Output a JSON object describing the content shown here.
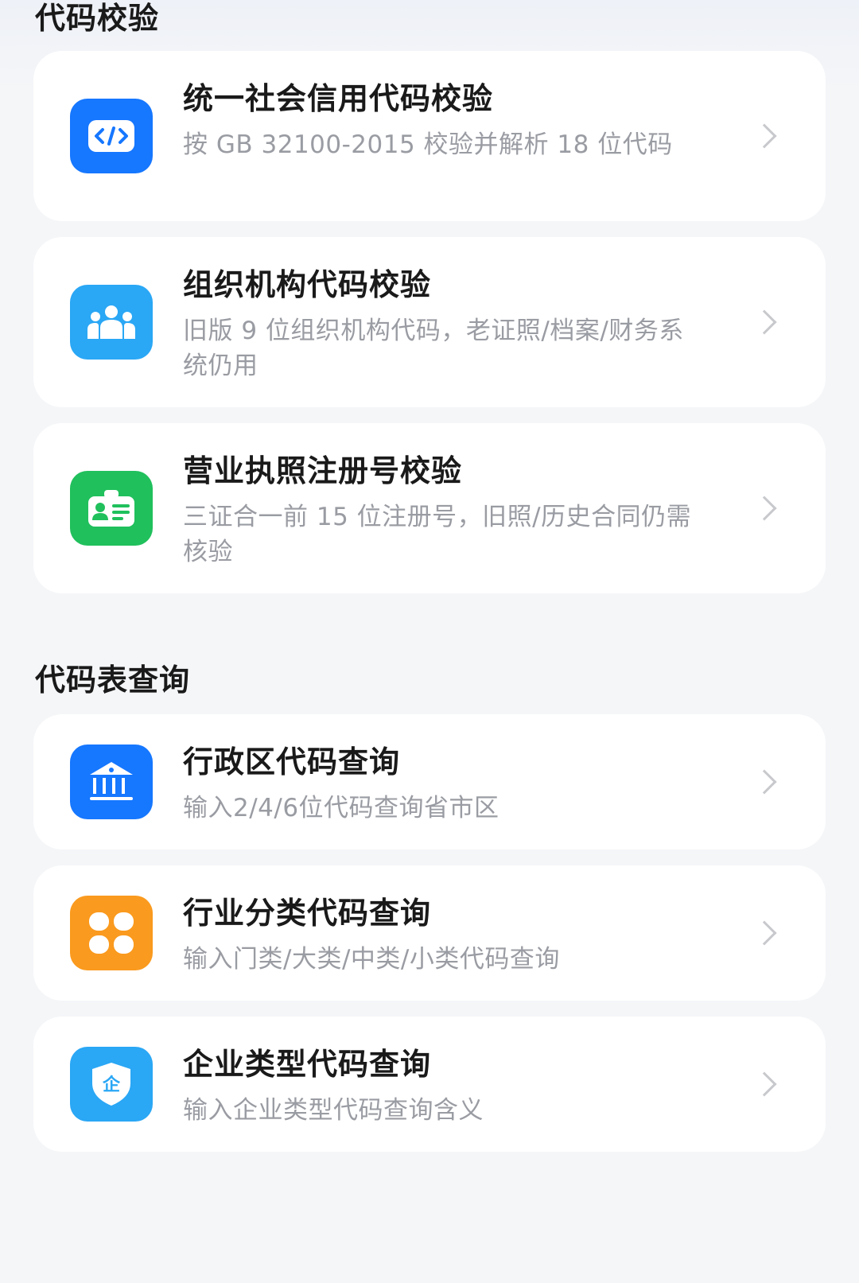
{
  "sections": [
    {
      "title": "代码校验",
      "items": [
        {
          "title": "统一社会信用代码校验",
          "desc": "按 GB 32100-2015 校验并解析 18 位代码",
          "icon": "code-icon",
          "color": "#1677ff"
        },
        {
          "title": "组织机构代码校验",
          "desc": "旧版 9 位组织机构代码，老证照/档案/财务系统仍用",
          "icon": "people-icon",
          "color": "#2aa7f5"
        },
        {
          "title": "营业执照注册号校验",
          "desc": "三证合一前 15 位注册号，旧照/历史合同仍需核验",
          "icon": "id-card-icon",
          "color": "#20c05c"
        }
      ]
    },
    {
      "title": "代码表查询",
      "items": [
        {
          "title": "行政区代码查询",
          "desc": "输入2/4/6位代码查询省市区",
          "icon": "government-building-icon",
          "color": "#1677ff"
        },
        {
          "title": "行业分类代码查询",
          "desc": "输入门类/大类/中类/小类代码查询",
          "icon": "grid-icon",
          "color": "#fa9a1e"
        },
        {
          "title": "企业类型代码查询",
          "desc": "输入企业类型代码查询含义",
          "icon": "enterprise-shield-icon",
          "color": "#2aa7f5",
          "glyph": "企"
        }
      ]
    }
  ]
}
